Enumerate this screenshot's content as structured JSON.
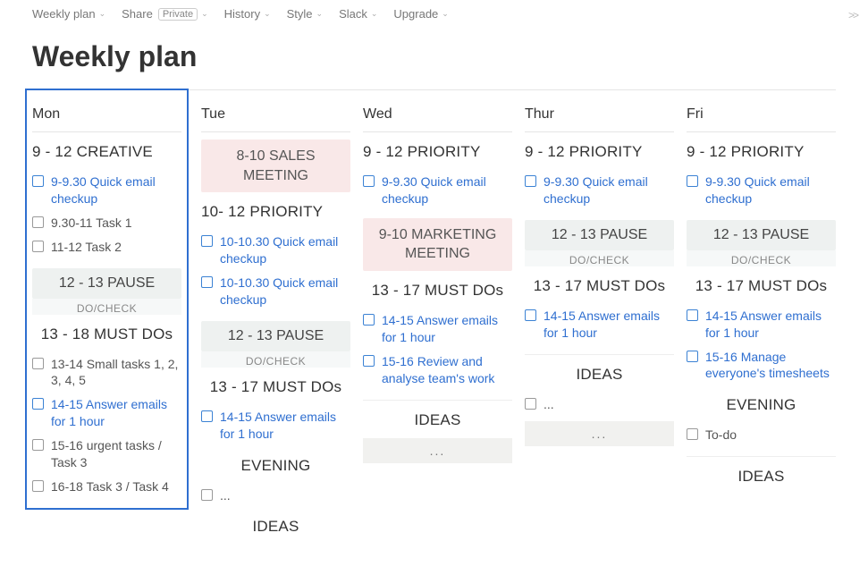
{
  "topbar": {
    "items": [
      {
        "label": "Weekly plan",
        "chevron": true
      },
      {
        "label": "Share",
        "badge": "Private",
        "chevron": true
      },
      {
        "label": "History",
        "chevron": true
      },
      {
        "label": "Style",
        "chevron": true
      },
      {
        "label": "Slack",
        "chevron": true
      },
      {
        "label": "Upgrade",
        "chevron": true
      }
    ]
  },
  "title": "Weekly plan",
  "columns": [
    {
      "day": "Mon",
      "selected": true,
      "blocks": [
        {
          "type": "heading",
          "text": "9 - 12 CREATIVE",
          "align": "left"
        },
        {
          "type": "tasks",
          "items": [
            {
              "text": "9-9.30 Quick email checkup",
              "link": true
            },
            {
              "text": "9.30-11 Task 1",
              "link": false
            },
            {
              "text": "11-12 Task 2",
              "link": false
            }
          ]
        },
        {
          "type": "pause",
          "title": "12 - 13 PAUSE",
          "sub": "DO/CHECK"
        },
        {
          "type": "heading",
          "text": "13 - 18 MUST DOs"
        },
        {
          "type": "tasks",
          "items": [
            {
              "text": "13-14 Small tasks 1, 2, 3, 4, 5",
              "link": false
            },
            {
              "text": "14-15 Answer emails for 1 hour",
              "link": true
            },
            {
              "text": "15-16 urgent tasks / Task 3",
              "link": false
            },
            {
              "text": "16-18 Task 3 / Task 4",
              "link": false
            }
          ]
        }
      ]
    },
    {
      "day": "Tue",
      "blocks": [
        {
          "type": "pill-pink",
          "text": "8-10 SALES MEETING"
        },
        {
          "type": "heading",
          "text": "10- 12 PRIORITY",
          "align": "left"
        },
        {
          "type": "tasks",
          "items": [
            {
              "text": "10-10.30 Quick email checkup",
              "link": true
            },
            {
              "text": "10-10.30 Quick email checkup",
              "link": true
            }
          ]
        },
        {
          "type": "pause",
          "title": "12 - 13 PAUSE",
          "sub": "DO/CHECK"
        },
        {
          "type": "heading",
          "text": "13 - 17 MUST DOs"
        },
        {
          "type": "tasks",
          "items": [
            {
              "text": "14-15 Answer emails for 1 hour",
              "link": true
            }
          ]
        },
        {
          "type": "heading",
          "text": "EVENING"
        },
        {
          "type": "tasks",
          "items": [
            {
              "text": "...",
              "link": false
            }
          ]
        },
        {
          "type": "heading",
          "text": "IDEAS"
        }
      ]
    },
    {
      "day": "Wed",
      "blocks": [
        {
          "type": "heading",
          "text": "9 - 12 PRIORITY",
          "align": "left"
        },
        {
          "type": "tasks",
          "items": [
            {
              "text": "9-9.30 Quick email checkup",
              "link": true
            }
          ]
        },
        {
          "type": "pill-pink",
          "text": "9-10 MARKETING MEETING"
        },
        {
          "type": "heading",
          "text": "13 - 17 MUST DOs"
        },
        {
          "type": "tasks",
          "items": [
            {
              "text": "14-15 Answer emails for 1 hour",
              "link": true
            },
            {
              "text": "15-16 Review and analyse team's work",
              "link": true
            }
          ]
        },
        {
          "type": "rule"
        },
        {
          "type": "heading",
          "text": "IDEAS"
        },
        {
          "type": "placeholder",
          "text": "..."
        }
      ]
    },
    {
      "day": "Thur",
      "blocks": [
        {
          "type": "heading",
          "text": "9 - 12 PRIORITY",
          "align": "left"
        },
        {
          "type": "tasks",
          "items": [
            {
              "text": "9-9.30 Quick email checkup",
              "link": true
            }
          ]
        },
        {
          "type": "pause",
          "title": "12 - 13 PAUSE",
          "sub": "DO/CHECK"
        },
        {
          "type": "heading",
          "text": "13 - 17 MUST DOs"
        },
        {
          "type": "tasks",
          "items": [
            {
              "text": "14-15 Answer emails for 1 hour",
              "link": true
            }
          ]
        },
        {
          "type": "rule"
        },
        {
          "type": "heading",
          "text": "IDEAS"
        },
        {
          "type": "tasks",
          "items": [
            {
              "text": "...",
              "link": false
            }
          ]
        },
        {
          "type": "placeholder",
          "text": "..."
        }
      ]
    },
    {
      "day": "Fri",
      "blocks": [
        {
          "type": "heading",
          "text": "9 - 12 PRIORITY",
          "align": "left"
        },
        {
          "type": "tasks",
          "items": [
            {
              "text": "9-9.30 Quick email checkup",
              "link": true
            }
          ]
        },
        {
          "type": "pause",
          "title": "12 - 13 PAUSE",
          "sub": "DO/CHECK"
        },
        {
          "type": "heading",
          "text": "13 - 17 MUST DOs"
        },
        {
          "type": "tasks",
          "items": [
            {
              "text": "14-15 Answer emails for 1 hour",
              "link": true
            },
            {
              "text": "15-16 Manage everyone's timesheets",
              "link": true
            }
          ]
        },
        {
          "type": "heading",
          "text": "EVENING"
        },
        {
          "type": "tasks",
          "items": [
            {
              "text": "To-do",
              "link": false
            }
          ]
        },
        {
          "type": "rule"
        },
        {
          "type": "heading",
          "text": "IDEAS"
        }
      ]
    }
  ]
}
